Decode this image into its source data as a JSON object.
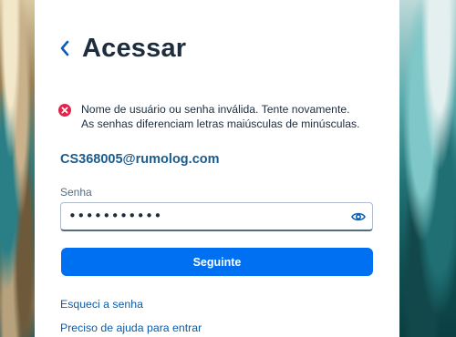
{
  "header": {
    "title": "Acessar"
  },
  "error": {
    "line1": "Nome de usuário ou senha inválida. Tente novamente.",
    "line2": "As senhas diferenciam letras maiúsculas de minúsculas."
  },
  "user": {
    "email": "CS368005@rumolog.com"
  },
  "password": {
    "label": "Senha",
    "value": "•••••••••••"
  },
  "actions": {
    "submit_label": "Seguinte",
    "forgot_link": "Esqueci a senha",
    "help_link": "Preciso de ajuda para entrar"
  },
  "icons": {
    "back": "chevron-left-icon",
    "error": "error-circle-icon",
    "show_password": "eye-icon"
  },
  "colors": {
    "accent": "#0070f2",
    "error": "#e0244a",
    "title": "#1d2d3e",
    "link": "#0b5ba8"
  }
}
